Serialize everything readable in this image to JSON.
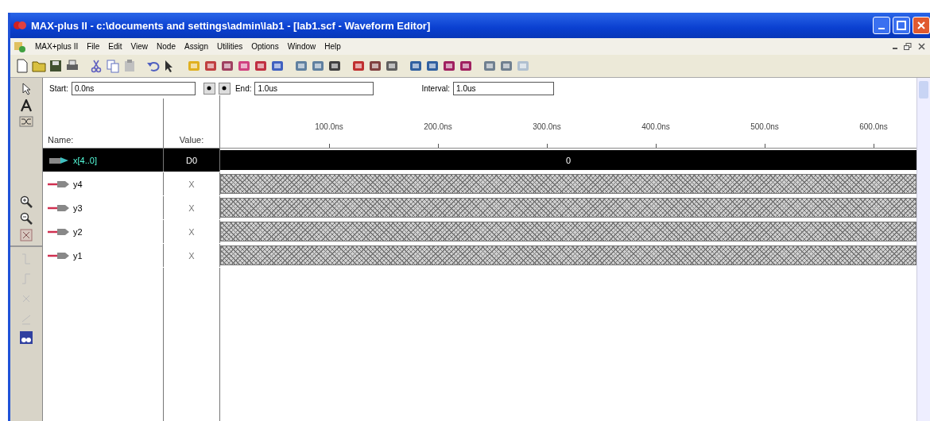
{
  "window": {
    "title": "MAX-plus II - c:\\documents and settings\\admin\\lab1 - [lab1.scf - Waveform Editor]"
  },
  "menu": [
    "MAX+plus II",
    "File",
    "Edit",
    "View",
    "Node",
    "Assign",
    "Utilities",
    "Options",
    "Window",
    "Help"
  ],
  "time_bar": {
    "start_label": "Start:",
    "start": "0.0ns",
    "end_label": "End:",
    "end": "1.0us",
    "interval_label": "Interval:",
    "interval": "1.0us"
  },
  "columns": {
    "name": "Name:",
    "value": "Value:"
  },
  "ruler": [
    "100.0ns",
    "200.0ns",
    "300.0ns",
    "400.0ns",
    "500.0ns",
    "600.0ns"
  ],
  "signals": [
    {
      "name": "x[4..0]",
      "kind": "bus",
      "value": "D0",
      "wave": {
        "kind": "value",
        "label": "0"
      },
      "selected": true
    },
    {
      "name": "y4",
      "kind": "input",
      "value": "X",
      "wave": {
        "kind": "unknown"
      },
      "selected": false
    },
    {
      "name": "y3",
      "kind": "input",
      "value": "X",
      "wave": {
        "kind": "unknown"
      },
      "selected": false
    },
    {
      "name": "y2",
      "kind": "input",
      "value": "X",
      "wave": {
        "kind": "unknown"
      },
      "selected": false
    },
    {
      "name": "y1",
      "kind": "input",
      "value": "X",
      "wave": {
        "kind": "unknown"
      },
      "selected": false
    }
  ]
}
